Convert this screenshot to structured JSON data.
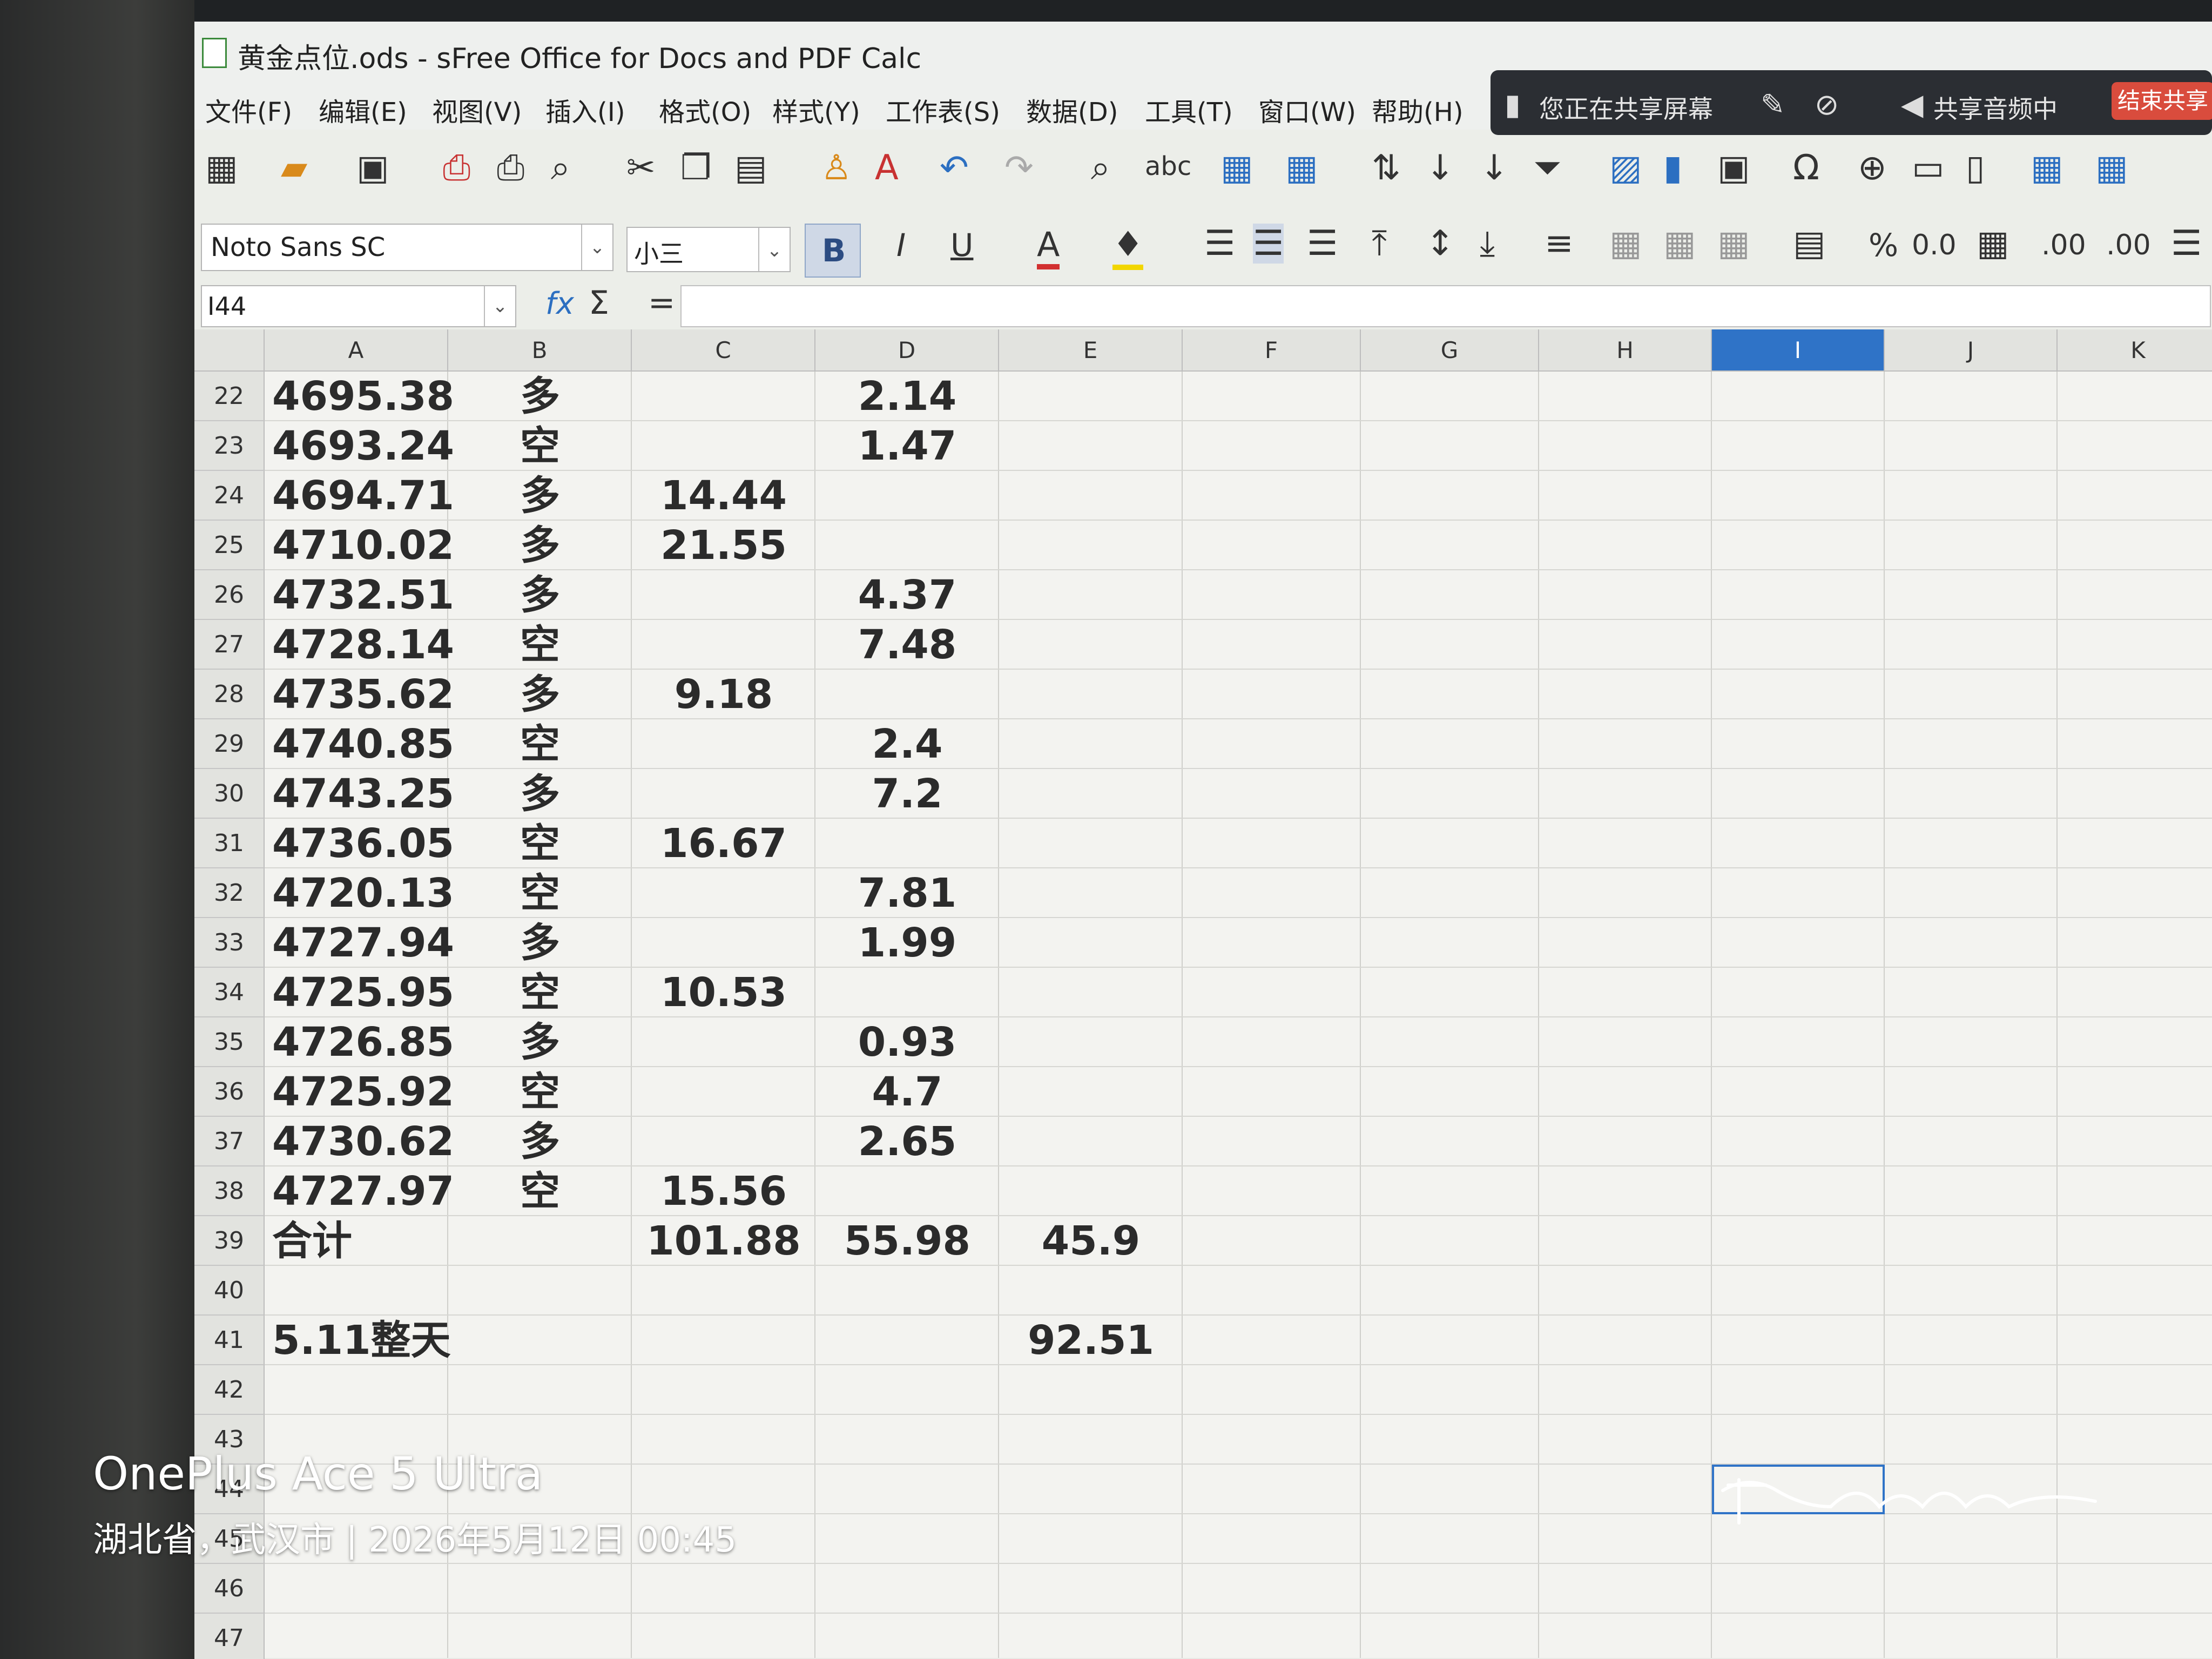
{
  "window": {
    "title": "黄金点位.ods - sFree Office for Docs and PDF Calc"
  },
  "share_banner": {
    "status": "您正在共享屏幕",
    "audio": "共享音频中",
    "end_button": "结束共享"
  },
  "menu": [
    "文件(F)",
    "编辑(E)",
    "视图(V)",
    "插入(I)",
    "格式(O)",
    "样式(Y)",
    "工作表(S)",
    "数据(D)",
    "工具(T)",
    "窗口(W)",
    "帮助(H)"
  ],
  "format_bar": {
    "font_name": "Noto Sans SC",
    "font_size": "小三",
    "bold": "B",
    "italic": "I",
    "underline": "U",
    "font_color": "A",
    "percent": "%",
    "number_fmt": "0.0",
    "add_decimal": ".00",
    "del_decimal": ".00"
  },
  "formula_bar": {
    "cell_ref": "I44",
    "fx": "fx",
    "sum": "Σ",
    "equals": "="
  },
  "toolbar": {
    "spell": "abc"
  },
  "sheet": {
    "columns": [
      "A",
      "B",
      "C",
      "D",
      "E",
      "F",
      "G",
      "H",
      "I",
      "J",
      "K"
    ],
    "selected_column": "I",
    "rows": [
      {
        "n": "22",
        "a": "4695.38",
        "b": "多",
        "c": "",
        "d": "2.14",
        "e": ""
      },
      {
        "n": "23",
        "a": "4693.24",
        "b": "空",
        "c": "",
        "d": "1.47",
        "e": ""
      },
      {
        "n": "24",
        "a": "4694.71",
        "b": "多",
        "c": "14.44",
        "d": "",
        "e": ""
      },
      {
        "n": "25",
        "a": "4710.02",
        "b": "多",
        "c": "21.55",
        "d": "",
        "e": ""
      },
      {
        "n": "26",
        "a": "4732.51",
        "b": "多",
        "c": "",
        "d": "4.37",
        "e": ""
      },
      {
        "n": "27",
        "a": "4728.14",
        "b": "空",
        "c": "",
        "d": "7.48",
        "e": ""
      },
      {
        "n": "28",
        "a": "4735.62",
        "b": "多",
        "c": "9.18",
        "d": "",
        "e": ""
      },
      {
        "n": "29",
        "a": "4740.85",
        "b": "空",
        "c": "",
        "d": "2.4",
        "e": ""
      },
      {
        "n": "30",
        "a": "4743.25",
        "b": "多",
        "c": "",
        "d": "7.2",
        "e": ""
      },
      {
        "n": "31",
        "a": "4736.05",
        "b": "空",
        "c": "16.67",
        "d": "",
        "e": ""
      },
      {
        "n": "32",
        "a": "4720.13",
        "b": "空",
        "c": "",
        "d": "7.81",
        "e": ""
      },
      {
        "n": "33",
        "a": "4727.94",
        "b": "多",
        "c": "",
        "d": "1.99",
        "e": ""
      },
      {
        "n": "34",
        "a": "4725.95",
        "b": "空",
        "c": "10.53",
        "d": "",
        "e": ""
      },
      {
        "n": "35",
        "a": "4726.85",
        "b": "多",
        "c": "",
        "d": "0.93",
        "e": ""
      },
      {
        "n": "36",
        "a": "4725.92",
        "b": "空",
        "c": "",
        "d": "4.7",
        "e": ""
      },
      {
        "n": "37",
        "a": "4730.62",
        "b": "多",
        "c": "",
        "d": "2.65",
        "e": ""
      },
      {
        "n": "38",
        "a": "4727.97",
        "b": "空",
        "c": "15.56",
        "d": "",
        "e": ""
      },
      {
        "n": "39",
        "a": "合计",
        "b": "",
        "c": "101.88",
        "d": "55.98",
        "e": "45.9"
      },
      {
        "n": "40",
        "a": "",
        "b": "",
        "c": "",
        "d": "",
        "e": ""
      },
      {
        "n": "41",
        "a": "5.11整天",
        "b": "",
        "c": "",
        "d": "",
        "e": "92.51"
      },
      {
        "n": "42",
        "a": "",
        "b": "",
        "c": "",
        "d": "",
        "e": ""
      },
      {
        "n": "43",
        "a": "",
        "b": "",
        "c": "",
        "d": "",
        "e": ""
      },
      {
        "n": "44",
        "a": "",
        "b": "",
        "c": "",
        "d": "",
        "e": ""
      },
      {
        "n": "45",
        "a": "",
        "b": "",
        "c": "",
        "d": "",
        "e": ""
      },
      {
        "n": "46",
        "a": "",
        "b": "",
        "c": "",
        "d": "",
        "e": ""
      },
      {
        "n": "47",
        "a": "",
        "b": "",
        "c": "",
        "d": "",
        "e": ""
      }
    ]
  },
  "photo_watermark": {
    "device": "OnePlus Ace 5 Ultra",
    "location_time": "湖北省，武汉市 | 2026年5月12日 00:45"
  },
  "colors": {
    "selection": "#2f73c7",
    "end_share": "#d94c3d",
    "banner": "#2b2e33"
  }
}
